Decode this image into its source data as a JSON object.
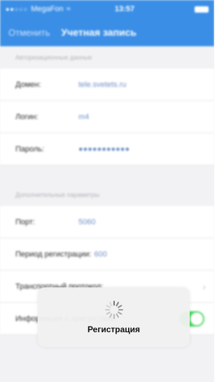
{
  "status_bar": {
    "carrier": "MegaFon",
    "time": "13:57"
  },
  "nav": {
    "cancel": "Отменить",
    "title": "Учетная запись"
  },
  "sections": [
    {
      "header": "Авторизационные данные",
      "rows": [
        {
          "label": "Домен:",
          "value": "tele.svetets.ru"
        },
        {
          "label": "Логин:",
          "value": "m4"
        },
        {
          "label": "Пароль:",
          "value": "●●●●●●●●●●●"
        }
      ]
    },
    {
      "header": "Дополнительные параметры",
      "rows": [
        {
          "label": "Порт:",
          "value": "5060"
        },
        {
          "label": "Период регистрации:",
          "value": "600"
        },
        {
          "label": "Транспортный протокол:",
          "value": ""
        },
        {
          "label": "Информация о присутствии:",
          "value": ""
        }
      ]
    }
  ],
  "toggles": {
    "presence_on": true
  },
  "colors": {
    "nav_bg": "#3a8ee6",
    "toggle_on": "#4cd964"
  },
  "hud": {
    "text": "Регистрация"
  }
}
